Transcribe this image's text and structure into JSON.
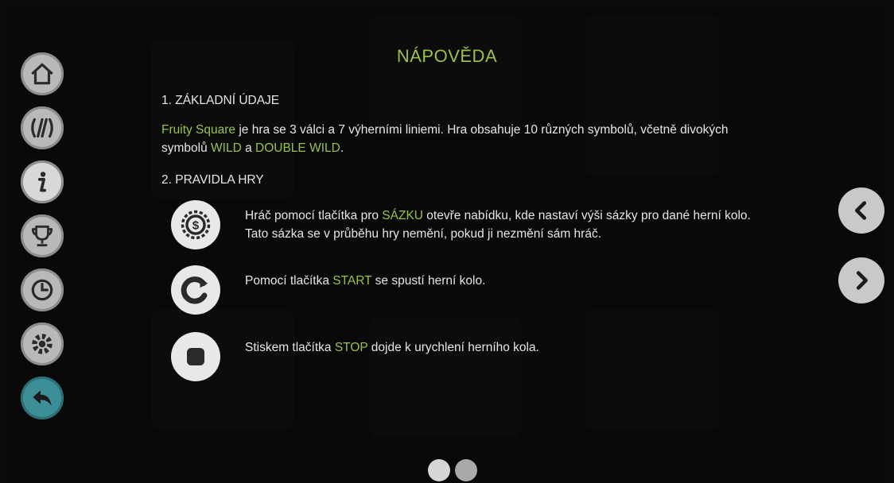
{
  "title": "NÁPOVĚDA",
  "colors": {
    "accent": "#9ac24a",
    "text": "#e6e6e6",
    "back_button": "#3d8f97",
    "icon_bg": "#b9b9b9"
  },
  "sidebar": [
    {
      "icon": "home-icon"
    },
    {
      "icon": "paylines-icon"
    },
    {
      "icon": "info-icon"
    },
    {
      "icon": "trophy-icon"
    },
    {
      "icon": "history-icon"
    },
    {
      "icon": "settings-icon"
    },
    {
      "icon": "back-icon"
    }
  ],
  "section1": {
    "heading": "1. ZÁKLADNÍ ÚDAJE",
    "line1_game": "Fruity Square",
    "line1_rest": " je hra se 3 válci a 7 výherními liniemi. Hra obsahuje 10 různých symbolů, včetně divokých",
    "line2_prefix": "symbolů ",
    "wild": "WILD",
    "line2_mid": " a ",
    "double_wild": "DOUBLE WILD",
    "line2_end": "."
  },
  "section2": {
    "heading": "2. PRAVIDLA HRY",
    "rules": [
      {
        "icon": "bet-coin-icon",
        "pre": "Hráč pomocí tlačítka pro ",
        "keyword": "SÁZKU",
        "post": " otevře nabídku, kde nastaví výši sázky pro dané herní kolo.",
        "line2": "Tato sázka se v průběhu hry nemění, pokud ji nezmění sám hráč."
      },
      {
        "icon": "start-icon",
        "pre": "Pomocí tlačítka ",
        "keyword": "START",
        "post": " se spustí herní kolo.",
        "line2": ""
      },
      {
        "icon": "stop-icon",
        "pre": "Stiskem tlačítka ",
        "keyword": "STOP",
        "post": " dojde k urychlení herního kola.",
        "line2": ""
      }
    ]
  },
  "navigation": {
    "prev_icon": "chevron-left-icon",
    "next_icon": "chevron-right-icon"
  },
  "pager": {
    "page_count": 2,
    "active": 1
  }
}
